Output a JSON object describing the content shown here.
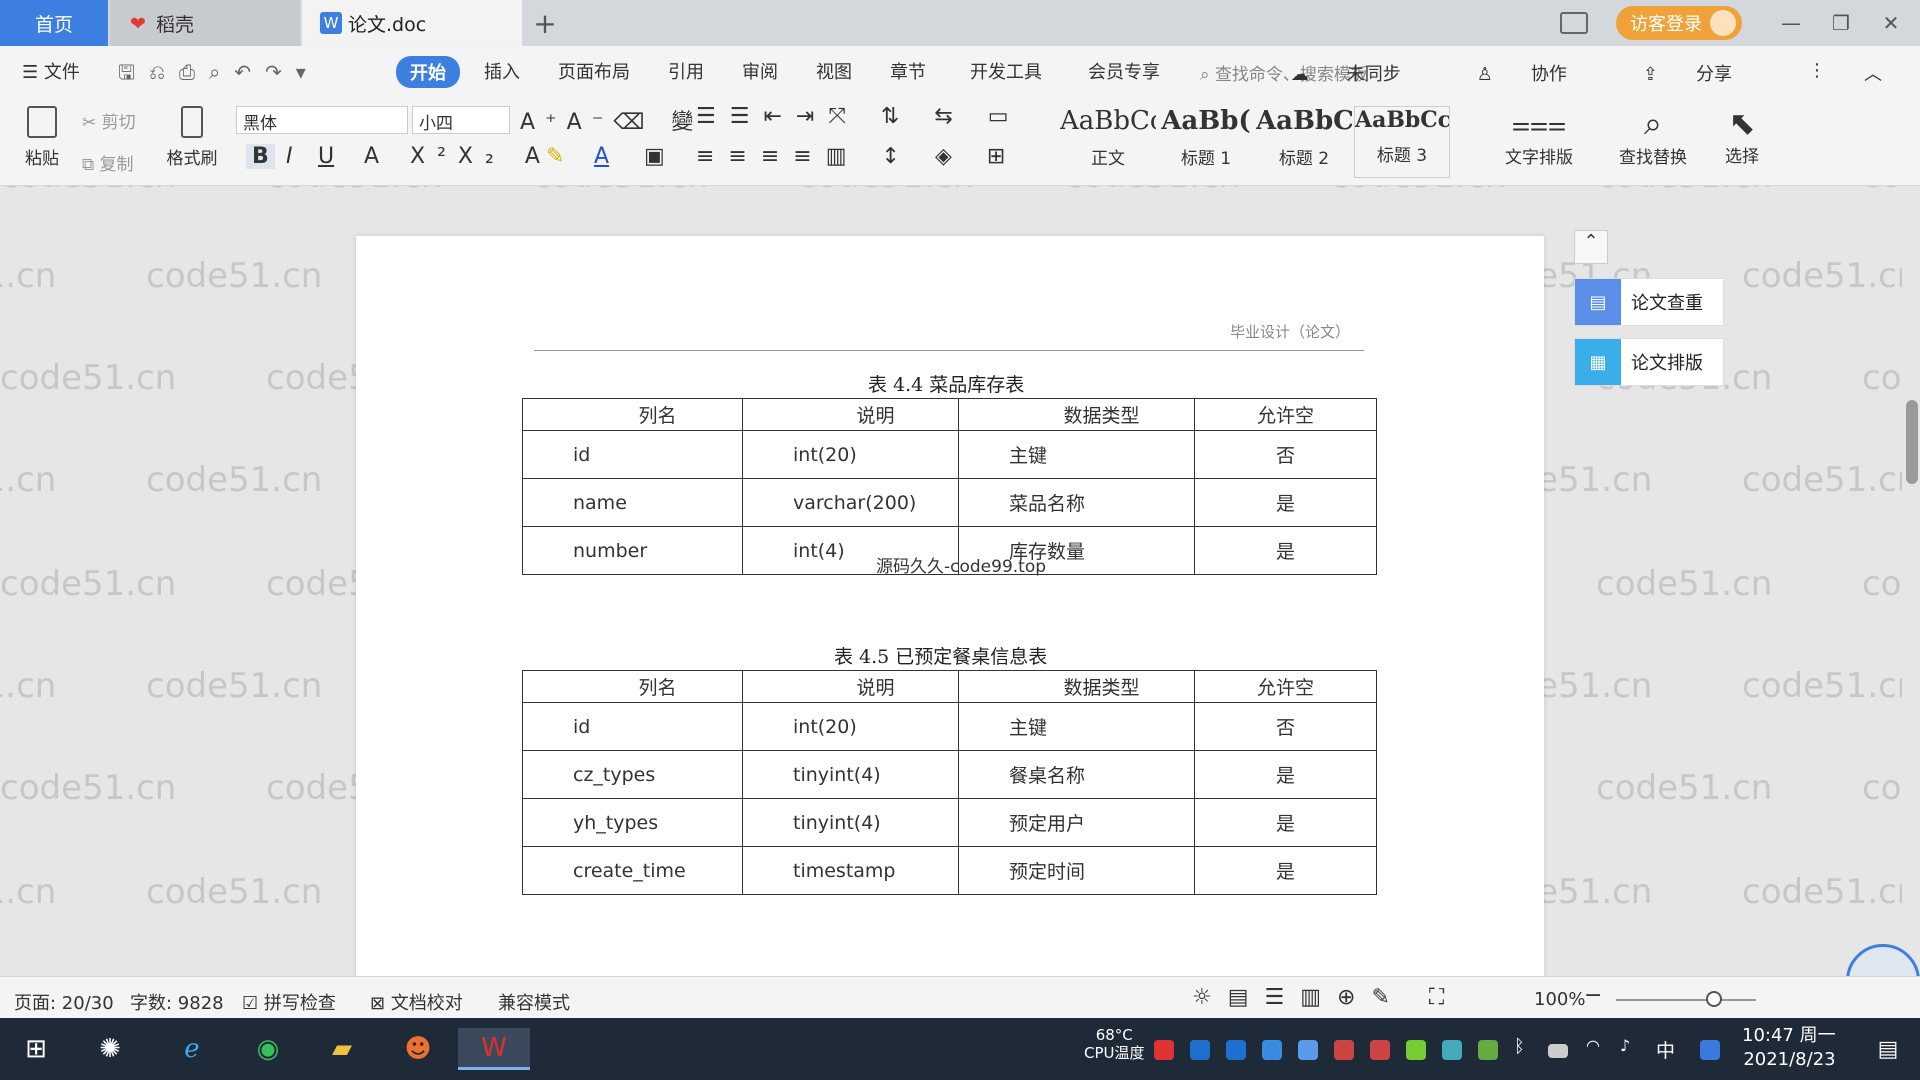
{
  "tabs": {
    "home": "首页",
    "daoke": "稻壳",
    "doc": "论文.doc",
    "add": "+"
  },
  "titlebar": {
    "guest_login": "访客登录"
  },
  "menu": {
    "file": "文件",
    "start": "开始",
    "insert": "插入",
    "page_layout": "页面布局",
    "reference": "引用",
    "review": "审阅",
    "view": "视图",
    "chapter": "章节",
    "dev_tools": "开发工具",
    "member": "会员专享",
    "search_placeholder": "查找命令、搜索模板",
    "not_synced": "未同步",
    "collaborate": "协作",
    "share": "分享"
  },
  "ribbon": {
    "paste": "粘贴",
    "cut": "剪切",
    "copy": "复制",
    "format_painter": "格式刷",
    "font_name": "黑体",
    "font_size": "小四",
    "styles": [
      {
        "preview": "AaBbCcI",
        "label": "正文"
      },
      {
        "preview": "AaBb(",
        "label": "标题 1"
      },
      {
        "preview": "AaBbC",
        "label": "标题 2"
      },
      {
        "preview": "AaBbCcl",
        "label": "标题 3"
      }
    ],
    "text_layout": "文字排版",
    "find_replace": "查找替换",
    "select": "选择"
  },
  "document": {
    "header": "毕业设计（论文）",
    "table1": {
      "caption": "表 4.4 菜品库存表",
      "headers": [
        "列名",
        "说明",
        "数据类型",
        "允许空"
      ],
      "rows": [
        [
          "id",
          "int(20)",
          "主键",
          "否"
        ],
        [
          "name",
          "varchar(200)",
          "菜品名称",
          "是"
        ],
        [
          "number",
          "int(4)",
          "库存数量",
          "是"
        ]
      ]
    },
    "table2": {
      "caption": "表 4.5  已预定餐桌信息表",
      "headers": [
        "列名",
        "说明",
        "数据类型",
        "允许空"
      ],
      "rows": [
        [
          "id",
          "int(20)",
          "主键",
          "否"
        ],
        [
          "cz_types",
          "tinyint(4)",
          "餐桌名称",
          "是"
        ],
        [
          "yh_types",
          "tinyint(4)",
          "预定用户",
          "是"
        ],
        [
          "create_time",
          "timestamp",
          "预定时间",
          "是"
        ]
      ]
    },
    "stamp": "源码久久-code99.top",
    "watermark": "code51.cn"
  },
  "side_panel": {
    "paper_check": "论文查重",
    "paper_layout": "论文排版"
  },
  "statusbar": {
    "page": "页面: 20/30",
    "words": "字数: 9828",
    "spell_check": "拼写检查",
    "doc_proof": "文档校对",
    "compat_mode": "兼容模式",
    "zoom": "100%"
  },
  "taskbar": {
    "temp": "68°C",
    "temp_label": "CPU温度",
    "ime": "中",
    "time": "10:47 周一",
    "date": "2021/8/23"
  }
}
